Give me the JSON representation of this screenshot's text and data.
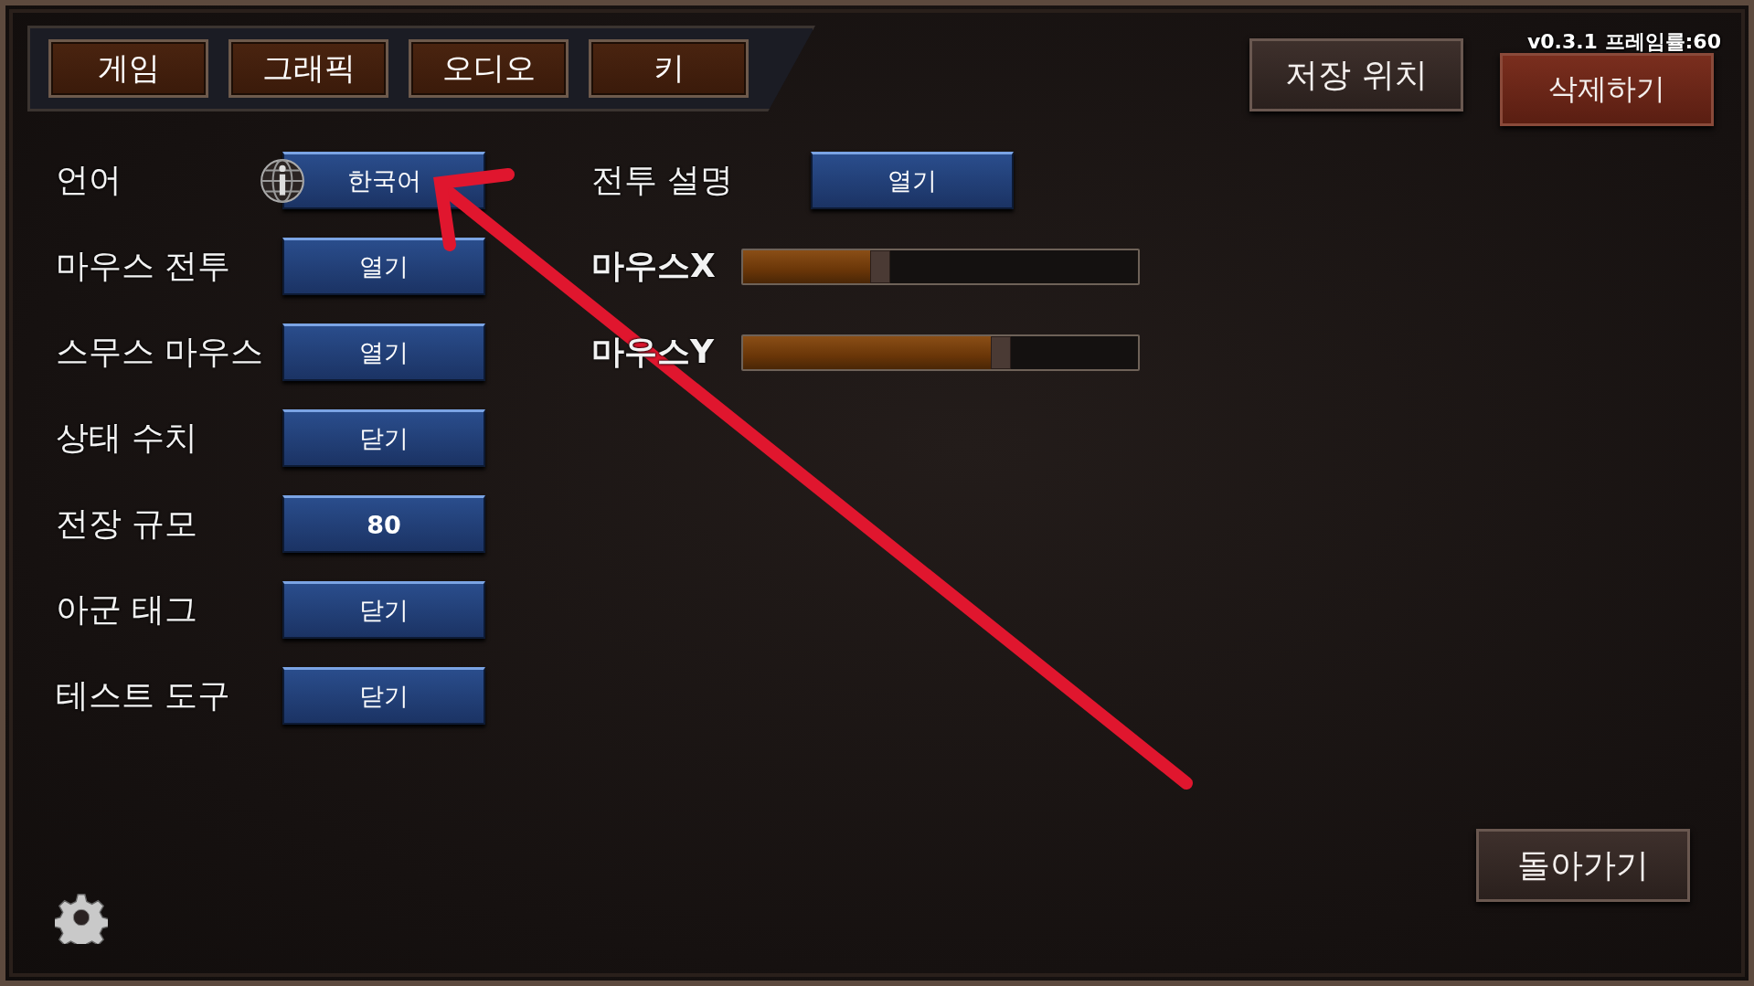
{
  "tabs": [
    {
      "label": "게임"
    },
    {
      "label": "그래픽"
    },
    {
      "label": "오디오"
    },
    {
      "label": "키"
    }
  ],
  "top_buttons": [
    {
      "label": "저장 위치",
      "kind": "dark"
    },
    {
      "label": "삭제하기",
      "kind": "red"
    }
  ],
  "version": "v0.3.1 프레임률:60",
  "left_settings": [
    {
      "label": "언어",
      "kind": "language",
      "value": "한국어"
    },
    {
      "label": "마우스 전투",
      "kind": "button",
      "value": "열기"
    },
    {
      "label": "스무스 마우스",
      "kind": "button",
      "value": "열기"
    },
    {
      "label": "상태 수치",
      "kind": "button",
      "value": "닫기"
    },
    {
      "label": "전장 규모",
      "kind": "number",
      "value": "80"
    },
    {
      "label": "아군 태그",
      "kind": "button",
      "value": "닫기"
    },
    {
      "label": "테스트 도구",
      "kind": "button",
      "value": "닫기"
    }
  ],
  "right_settings": [
    {
      "label": "전투 설명",
      "kind": "button",
      "value": "열기"
    },
    {
      "label": "마우스X",
      "kind": "slider",
      "level": 0.34
    },
    {
      "label": "마우스Y",
      "kind": "slider",
      "level": 0.66
    }
  ],
  "back_button": "돌아가기"
}
